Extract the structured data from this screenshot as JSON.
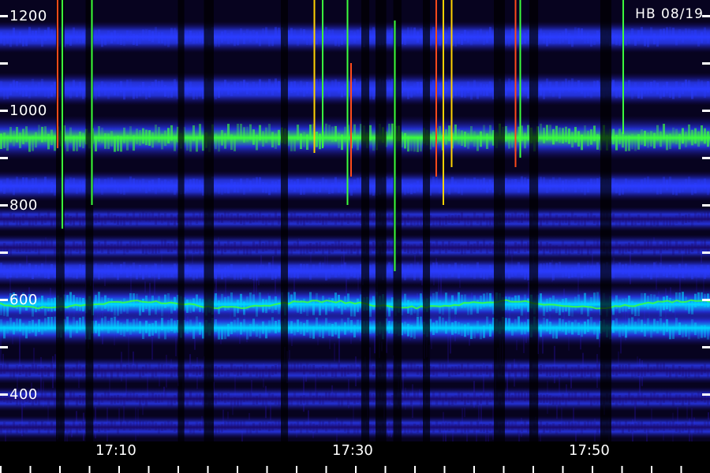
{
  "chart_data": {
    "type": "heatmap",
    "title": "HB 08/19",
    "xlabel": "",
    "ylabel": "",
    "x_tick_labels": [
      "17:10",
      "17:30",
      "17:50"
    ],
    "y_tick_labels": [
      "400",
      "600",
      "800",
      "1000",
      "1200"
    ],
    "x_ticks_minutes": [
      10,
      30,
      50
    ],
    "xlim_minutes": [
      2,
      62
    ],
    "y_ticks": [
      400,
      600,
      800,
      1000,
      1200
    ],
    "ylim": [
      200,
      1210
    ],
    "colors": {
      "background": "#000000",
      "low": "#1a0a6e",
      "mid": "#2a3cff",
      "high": "#00d8ff",
      "peak": "#3cff3c",
      "burst_red": "#ff4a1a",
      "burst_yellow": "#ffd200",
      "axis": "#ffffff"
    },
    "bands": [
      {
        "y": 1175,
        "intensity": 0.25
      },
      {
        "y": 1055,
        "intensity": 0.55
      },
      {
        "y": 945,
        "intensity": 0.6
      },
      {
        "y": 842,
        "intensity": 1.0
      },
      {
        "y": 740,
        "intensity": 0.5
      },
      {
        "y": 670,
        "intensity": 0.3
      },
      {
        "y": 610,
        "intensity": 0.35
      },
      {
        "y": 560,
        "intensity": 0.45
      },
      {
        "y": 490,
        "intensity": 0.8
      },
      {
        "y": 440,
        "intensity": 0.7
      },
      {
        "y": 350,
        "intensity": 0.35
      },
      {
        "y": 290,
        "intensity": 0.3
      },
      {
        "y": 230,
        "intensity": 0.25
      }
    ],
    "gaps_minutes": [
      7,
      9.5,
      17.3,
      19.5,
      26,
      32.8,
      34,
      35.5,
      38,
      44,
      47,
      53
    ],
    "bursts": [
      {
        "t": 6.8,
        "color": "burst_red",
        "y0": 820,
        "y1": 1210
      },
      {
        "t": 7.2,
        "color": "peak",
        "y0": 650,
        "y1": 1210
      },
      {
        "t": 9.7,
        "color": "peak",
        "y0": 700,
        "y1": 1200
      },
      {
        "t": 28.5,
        "color": "burst_yellow",
        "y0": 810,
        "y1": 1210
      },
      {
        "t": 29.2,
        "color": "peak",
        "y0": 820,
        "y1": 1210
      },
      {
        "t": 31.3,
        "color": "peak",
        "y0": 700,
        "y1": 1210
      },
      {
        "t": 31.6,
        "color": "burst_red",
        "y0": 760,
        "y1": 1000
      },
      {
        "t": 35.3,
        "color": "peak",
        "y0": 560,
        "y1": 1090
      },
      {
        "t": 38.8,
        "color": "burst_red",
        "y0": 760,
        "y1": 1210
      },
      {
        "t": 39.4,
        "color": "burst_yellow",
        "y0": 700,
        "y1": 1210
      },
      {
        "t": 40.1,
        "color": "burst_yellow",
        "y0": 780,
        "y1": 1210
      },
      {
        "t": 45.5,
        "color": "burst_red",
        "y0": 780,
        "y1": 1210
      },
      {
        "t": 45.9,
        "color": "peak",
        "y0": 800,
        "y1": 1210
      },
      {
        "t": 54.6,
        "color": "peak",
        "y0": 850,
        "y1": 1210
      }
    ]
  }
}
